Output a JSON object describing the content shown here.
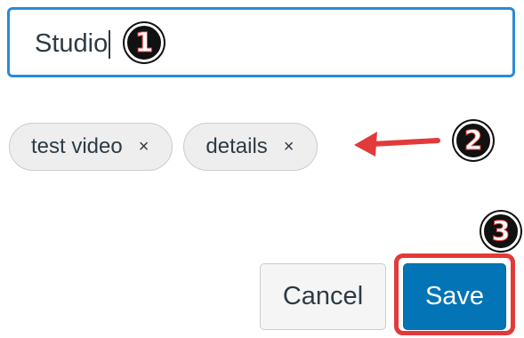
{
  "tag_input": {
    "value": "Studio"
  },
  "tags": [
    {
      "label": "test video",
      "remove": "×"
    },
    {
      "label": "details",
      "remove": "×"
    }
  ],
  "buttons": {
    "cancel_label": "Cancel",
    "save_label": "Save"
  },
  "steps": [
    "1",
    "2",
    "3"
  ],
  "colors": {
    "focus_border": "#2b8ad6",
    "save_bg": "#0374b5",
    "annotation_red": "#e23a3a"
  }
}
